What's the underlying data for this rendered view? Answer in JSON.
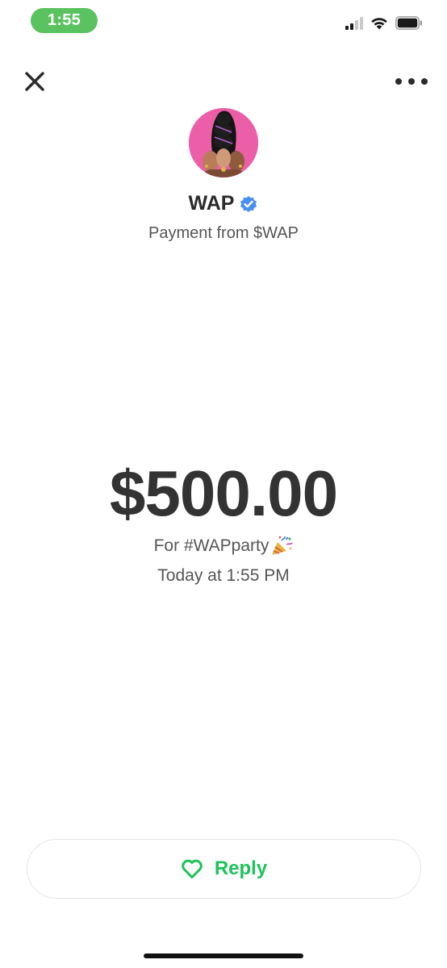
{
  "status_bar": {
    "time": "1:55",
    "accent_color": "#5ac35f",
    "icons": [
      "cellular-signal-icon",
      "wifi-icon",
      "battery-icon"
    ]
  },
  "nav": {
    "close_icon": "close-icon",
    "more_icon": "more-options-icon"
  },
  "payment": {
    "sender_name": "WAP",
    "verified_icon": "verified-badge-icon",
    "verified_color": "#4a8ff0",
    "subtitle": "Payment from $WAP",
    "amount": "$500.00",
    "note": "For #WAPparty",
    "note_emoji_icon": "party-popper-icon",
    "timestamp": "Today at 1:55 PM"
  },
  "actions": {
    "reply_label": "Reply",
    "reply_icon": "heart-outline-icon",
    "reply_color": "#1ec25b"
  }
}
